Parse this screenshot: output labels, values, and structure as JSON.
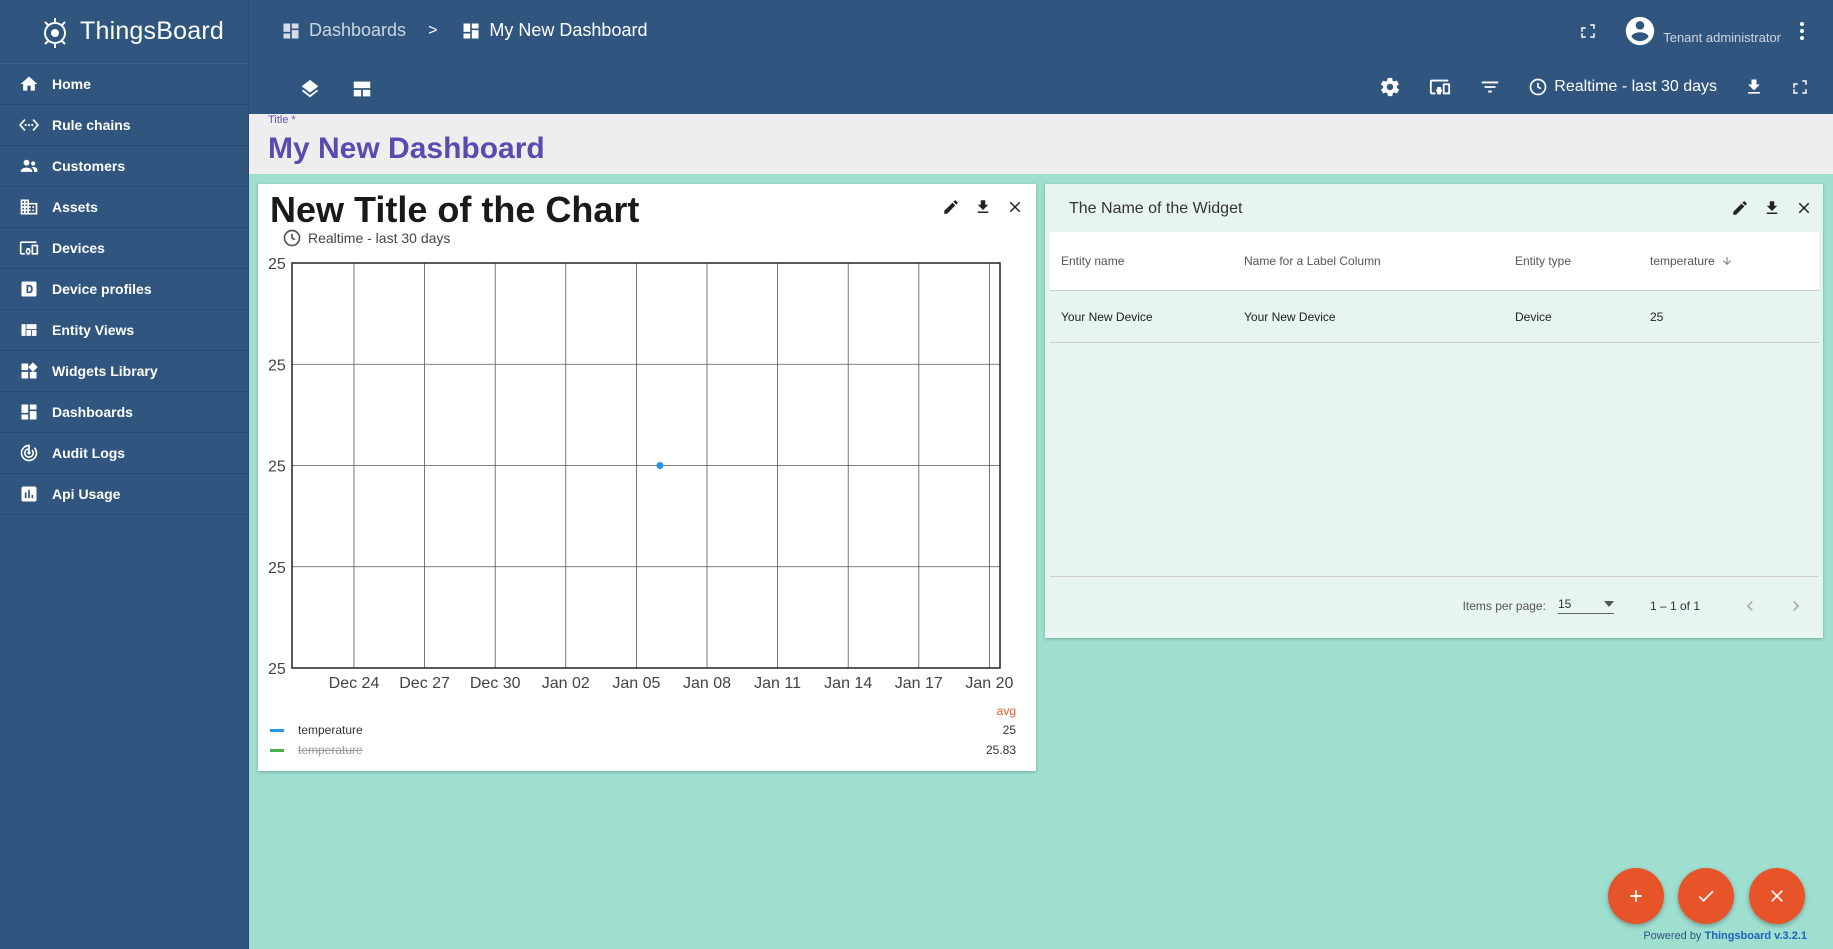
{
  "app": {
    "name": "ThingsBoard"
  },
  "sidebar": {
    "items": [
      {
        "label": "Home",
        "icon": "home-icon"
      },
      {
        "label": "Rule chains",
        "icon": "settings-ethernet-icon"
      },
      {
        "label": "Customers",
        "icon": "supervisor-account-icon"
      },
      {
        "label": "Assets",
        "icon": "domain-icon"
      },
      {
        "label": "Devices",
        "icon": "devices-other-icon"
      },
      {
        "label": "Device profiles",
        "icon": "device-profile-icon"
      },
      {
        "label": "Entity Views",
        "icon": "view-quilt-icon"
      },
      {
        "label": "Widgets Library",
        "icon": "widgets-icon"
      },
      {
        "label": "Dashboards",
        "icon": "dashboards-icon"
      },
      {
        "label": "Audit Logs",
        "icon": "track-changes-icon"
      },
      {
        "label": "Api Usage",
        "icon": "insert-chart-icon"
      }
    ]
  },
  "header": {
    "breadcrumb": {
      "parent": "Dashboards",
      "separator": ">",
      "current": "My New Dashboard"
    },
    "user": {
      "role": "Tenant administrator"
    },
    "timewindow": "Realtime - last 30 days"
  },
  "title_field": {
    "label": "Title *",
    "value": "My New Dashboard"
  },
  "chart_widget": {
    "title": "New Title of the Chart",
    "subtitle": "Realtime - last 30 days",
    "legend": {
      "header": "avg",
      "rows": [
        {
          "name": "temperature",
          "value": "25",
          "color": "#2196f3",
          "hidden": false
        },
        {
          "name": "temperature",
          "value": "25.83",
          "color": "#4caf50",
          "hidden": true
        }
      ]
    }
  },
  "chart_data": {
    "type": "line",
    "title": "New Title of the Chart",
    "x_ticks": [
      "Dec 24",
      "Dec 27",
      "Dec 30",
      "Jan 02",
      "Jan 05",
      "Jan 08",
      "Jan 11",
      "Jan 14",
      "Jan 17",
      "Jan 20"
    ],
    "y_ticks": [
      "25",
      "25",
      "25",
      "25",
      "25"
    ],
    "series": [
      {
        "name": "temperature",
        "color": "#2196f3",
        "points": [
          {
            "x": "Jan 06",
            "y": 25
          }
        ]
      }
    ],
    "grid": true
  },
  "table_widget": {
    "title": "The Name of the Widget",
    "columns": [
      "Entity name",
      "Name for a Label Column",
      "Entity type",
      "temperature"
    ],
    "sort_icon": "arrow-downward-icon",
    "rows": [
      [
        "Your New Device",
        "Your New Device",
        "Device",
        "25"
      ]
    ],
    "paginator": {
      "items_per_page_label": "Items per page:",
      "items_per_page": "15",
      "range": "1 – 1 of 1"
    }
  },
  "footer": {
    "powered_prefix": "Powered by",
    "powered_link": "Thingsboard v.3.2.1"
  },
  "colors": {
    "primary": "#305680",
    "accent": "#e8542a",
    "canvas": "#9edfd0",
    "title": "#5a4bb0"
  }
}
